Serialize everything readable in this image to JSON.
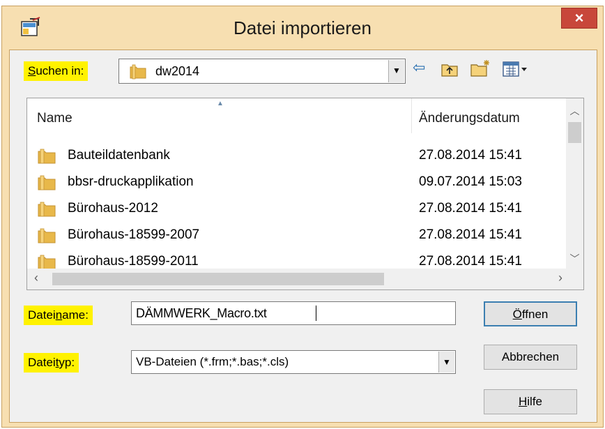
{
  "window": {
    "title": "Datei importieren",
    "close_label": "×"
  },
  "look_in": {
    "label_underline": "S",
    "label_rest": "uchen in:",
    "value": "dw2014"
  },
  "toolbar": {
    "icons": [
      "back-icon",
      "up-folder-icon",
      "new-folder-icon",
      "view-menu-icon"
    ]
  },
  "file_list": {
    "columns": [
      "Name",
      "Änderungsdatum"
    ],
    "rows": [
      {
        "name": "Bauteildatenbank",
        "date": "27.08.2014 15:41"
      },
      {
        "name": "bbsr-druckapplikation",
        "date": "09.07.2014 15:03"
      },
      {
        "name": "Bürohaus-2012",
        "date": "27.08.2014 15:41"
      },
      {
        "name": "Bürohaus-18599-2007",
        "date": "27.08.2014 15:41"
      },
      {
        "name": "Bürohaus-18599-2011",
        "date": "27.08.2014 15:41"
      }
    ]
  },
  "filename": {
    "label_a": "Datei",
    "label_u": "n",
    "label_b": "ame:",
    "value": "DÄMMWERK_Macro.txt"
  },
  "filetype": {
    "label_a": "Datei",
    "label_u": "t",
    "label_b": "yp:",
    "value": "VB-Dateien (*.frm;*.bas;*.cls)"
  },
  "buttons": {
    "open_u": "Ö",
    "open_rest": "ffnen",
    "cancel": "Abbrechen",
    "help_u": "H",
    "help_rest": "ilfe"
  },
  "colors": {
    "highlight": "#fff200",
    "frame": "#f7dfb1",
    "close": "#c8473a",
    "folder": "#e8b84a"
  }
}
